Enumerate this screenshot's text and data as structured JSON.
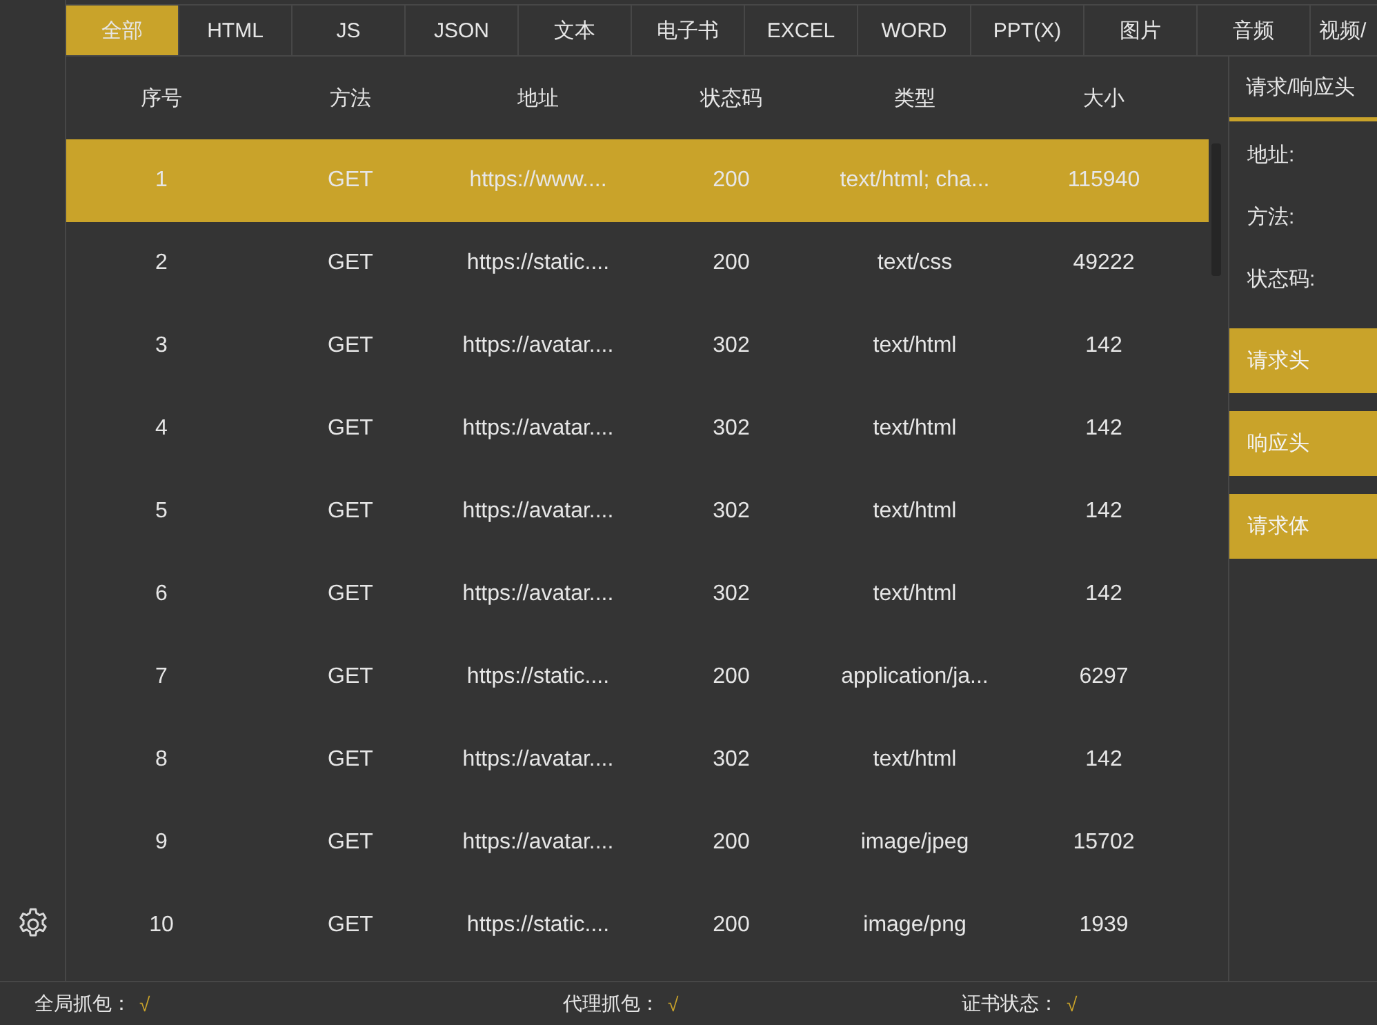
{
  "tabs": [
    {
      "label": "全部",
      "selected": true
    },
    {
      "label": "HTML",
      "selected": false
    },
    {
      "label": "JS",
      "selected": false
    },
    {
      "label": "JSON",
      "selected": false
    },
    {
      "label": "文本",
      "selected": false
    },
    {
      "label": "电子书",
      "selected": false
    },
    {
      "label": "EXCEL",
      "selected": false
    },
    {
      "label": "WORD",
      "selected": false
    },
    {
      "label": "PPT(X)",
      "selected": false
    },
    {
      "label": "图片",
      "selected": false
    },
    {
      "label": "音频",
      "selected": false
    },
    {
      "label": "视频/",
      "selected": false
    }
  ],
  "table": {
    "columns": [
      "序号",
      "方法",
      "地址",
      "状态码",
      "类型",
      "大小"
    ],
    "rows": [
      {
        "selected": true,
        "cells": [
          "1",
          "GET",
          "https://www....",
          "200",
          "text/html; cha...",
          "115940"
        ]
      },
      {
        "selected": false,
        "cells": [
          "2",
          "GET",
          "https://static....",
          "200",
          "text/css",
          "49222"
        ]
      },
      {
        "selected": false,
        "cells": [
          "3",
          "GET",
          "https://avatar....",
          "302",
          "text/html",
          "142"
        ]
      },
      {
        "selected": false,
        "cells": [
          "4",
          "GET",
          "https://avatar....",
          "302",
          "text/html",
          "142"
        ]
      },
      {
        "selected": false,
        "cells": [
          "5",
          "GET",
          "https://avatar....",
          "302",
          "text/html",
          "142"
        ]
      },
      {
        "selected": false,
        "cells": [
          "6",
          "GET",
          "https://avatar....",
          "302",
          "text/html",
          "142"
        ]
      },
      {
        "selected": false,
        "cells": [
          "7",
          "GET",
          "https://static....",
          "200",
          "application/ja...",
          "6297"
        ]
      },
      {
        "selected": false,
        "cells": [
          "8",
          "GET",
          "https://avatar....",
          "302",
          "text/html",
          "142"
        ]
      },
      {
        "selected": false,
        "cells": [
          "9",
          "GET",
          "https://avatar....",
          "200",
          "image/jpeg",
          "15702"
        ]
      },
      {
        "selected": false,
        "cells": [
          "10",
          "GET",
          "https://static....",
          "200",
          "image/png",
          "1939"
        ]
      }
    ]
  },
  "detail_panel": {
    "tabs": [
      {
        "label": "请求/响应头",
        "selected": true
      }
    ],
    "fields": [
      "地址:",
      "方法:",
      "状态码:"
    ],
    "buttons": [
      "请求头",
      "响应头",
      "请求体"
    ]
  },
  "status_bar": [
    {
      "label": "全局抓包：",
      "value": "√"
    },
    {
      "label": "代理抓包：",
      "value": "√"
    },
    {
      "label": "证书状态：",
      "value": "√"
    }
  ]
}
